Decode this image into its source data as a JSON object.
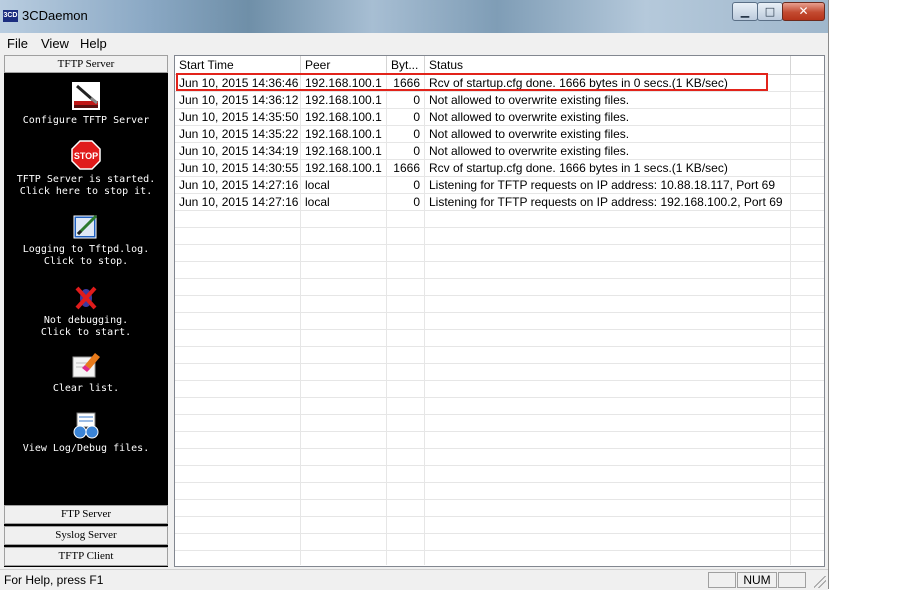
{
  "window": {
    "title": "3CDaemon",
    "app_icon": "3CD"
  },
  "menu": [
    "File",
    "View",
    "Help"
  ],
  "sidebar": {
    "active_header": "TFTP Server",
    "actions": [
      {
        "icon": "configure-icon",
        "label": "Configure TFTP Server"
      },
      {
        "icon": "stop-icon",
        "icon_text": "STOP",
        "label": "TFTP Server is started.\nClick here to stop it."
      },
      {
        "icon": "logging-icon",
        "label": "Logging to Tftpd.log.\nClick to stop."
      },
      {
        "icon": "debug-off-icon",
        "label": "Not debugging.\nClick to start."
      },
      {
        "icon": "clear-list-icon",
        "label": "Clear list."
      },
      {
        "icon": "view-log-icon",
        "label": "View Log/Debug files."
      }
    ],
    "bottom_buttons": [
      "FTP Server",
      "Syslog Server",
      "TFTP Client"
    ]
  },
  "table": {
    "columns": [
      "Start Time",
      "Peer",
      "Byt...",
      "Status"
    ],
    "rows": [
      [
        "Jun 10, 2015 14:36:46",
        "192.168.100.1",
        "1666",
        "Rcv of startup.cfg done. 1666 bytes in 0 secs.(1 KB/sec)"
      ],
      [
        "Jun 10, 2015 14:36:12",
        "192.168.100.1",
        "0",
        "Not allowed to overwrite existing files."
      ],
      [
        "Jun 10, 2015 14:35:50",
        "192.168.100.1",
        "0",
        "Not allowed to overwrite existing files."
      ],
      [
        "Jun 10, 2015 14:35:22",
        "192.168.100.1",
        "0",
        "Not allowed to overwrite existing files."
      ],
      [
        "Jun 10, 2015 14:34:19",
        "192.168.100.1",
        "0",
        "Not allowed to overwrite existing files."
      ],
      [
        "Jun 10, 2015 14:30:55",
        "192.168.100.1",
        "1666",
        "Rcv of startup.cfg done. 1666 bytes in 1 secs.(1 KB/sec)"
      ],
      [
        "Jun 10, 2015 14:27:16",
        "local",
        "0",
        "Listening for TFTP requests on IP address: 10.88.18.117, Port 69"
      ],
      [
        "Jun 10, 2015 14:27:16",
        "local",
        "0",
        "Listening for TFTP requests on IP address: 192.168.100.2, Port 69"
      ]
    ]
  },
  "statusbar": {
    "help_text": "For Help, press F1",
    "num_indicator": "NUM"
  },
  "colors": {
    "highlight": "#e2231a",
    "sidebar_bg": "#000000",
    "stop_red": "#e01b1b"
  }
}
